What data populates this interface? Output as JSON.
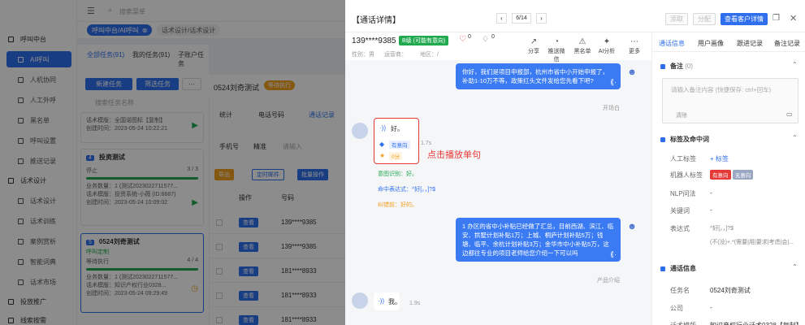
{
  "nav": {
    "items": [
      {
        "label": "呼叫中台",
        "type": "group"
      },
      {
        "label": "AI呼叫",
        "type": "active"
      },
      {
        "label": "人机协同"
      },
      {
        "label": "人工外呼"
      },
      {
        "label": "黑名单"
      },
      {
        "label": "呼叫设置"
      },
      {
        "label": "推送记录"
      },
      {
        "label": "话术设计",
        "type": "group"
      },
      {
        "label": "话术设计"
      },
      {
        "label": "话术训练"
      },
      {
        "label": "案例赏析"
      },
      {
        "label": "智能词典"
      },
      {
        "label": "话术市场"
      },
      {
        "label": "投放推广",
        "type": "group"
      },
      {
        "label": "线索按需",
        "type": "group"
      }
    ]
  },
  "topbar": {
    "search_placeholder": "搜索菜单"
  },
  "tabs": [
    {
      "label": "呼叫中台/AI呼叫"
    },
    {
      "label": "话术设计/话术设计"
    }
  ],
  "task_tabs": [
    "全部任务(91)",
    "我的任务(91)",
    "子账户任务"
  ],
  "list": {
    "new_button": "新建任务",
    "filter_button": "筛选任务",
    "more": "···",
    "search_placeholder": "搜索任务名称",
    "cards": [
      {
        "title": "",
        "lines": [
          "话术模版：全国诺图标【复制】",
          "创建时间：2023-05-24 10:22:21"
        ]
      },
      {
        "badge": "4",
        "title": "投资测试",
        "status": "停止",
        "progress_text": "3 / 3",
        "progress": 1.0,
        "lines": [
          "业务数量：1 (测试2023022711577...",
          "话术模版：投资系统-小薇 (ID:8687)",
          "创建时间：2023-05-24 10:09:02"
        ]
      },
      {
        "badge": "5",
        "title": "0524刘奇测试",
        "tag": "呼叫定制",
        "status": "等待执行",
        "progress_text": "4 / 4",
        "progress": 1.0,
        "lines": [
          "业务数量：1 (测试2023022711577...",
          "话术模版：知识产权行业0328...",
          "创建时间：2023-05-24 09:29:49"
        ]
      }
    ]
  },
  "detail": {
    "title": "0524刘奇测试",
    "status": "等待执行",
    "sub_tabs": [
      "统计",
      "电话号码",
      "通话记录",
      "..."
    ],
    "filters": [
      "手机号",
      "精准",
      "请输入"
    ],
    "actions": [
      "导出",
      "定时邮件",
      "批量操作"
    ],
    "columns": [
      "操作",
      "号码"
    ],
    "rows": [
      {
        "op": "查看",
        "num": "139****9385"
      },
      {
        "op": "查看",
        "num": "139****9385"
      },
      {
        "op": "查看",
        "num": "181****8933"
      },
      {
        "op": "查看",
        "num": "181****8933"
      },
      {
        "op": "查看",
        "num": "181****8933"
      }
    ]
  },
  "drawer": {
    "title": "【通话详情】",
    "pager": "6/14",
    "header_buttons": [
      "添取",
      "分配",
      "查看客户详情"
    ],
    "phone": "139****9385",
    "level_tag": "B级 (可能有意向)",
    "likes": "0",
    "dislikes": "0",
    "sub_info": [
      "性别：男",
      "运营商：",
      "地区：/"
    ],
    "icon_actions": [
      {
        "label": "分享",
        "icon": "share-icon",
        "glyph": "↗"
      },
      {
        "label": "推送微信",
        "icon": "chat-icon",
        "glyph": "◔"
      },
      {
        "label": "黑名单",
        "icon": "warning-icon",
        "glyph": "⚠"
      },
      {
        "label": "AI分析",
        "icon": "ai-icon",
        "glyph": "✦"
      },
      {
        "label": "更多",
        "icon": "more-icon",
        "glyph": "⋯"
      }
    ]
  },
  "chat": {
    "msg1": "你好，我们是项目申报部，杭州市省中小开始申报了，补助1-10万不等，政策红头文件发给您先看下吧?",
    "msg1_tag": "开场白",
    "reply1": "好。",
    "reply1_time": "1.7s",
    "reply1_tags": [
      "有意向",
      "0分"
    ],
    "annotation": "点击播放单句",
    "intent_lines": [
      "意图识别：好。",
      "命中表达式：^好[。，]?$",
      "纠错前：好的。"
    ],
    "msg2": "1 办区的省中小补贴已经做了汇总，目前西湖、滨江、临安、拱墅计划补贴1万；上城、桐庐计划补贴5万；钱塘、临平、余杭计划补贴3万；金华市中小补贴5万，这边都往专业的项目老师给您介绍一下可以吗",
    "msg2_tag": "产品介绍",
    "reply2": "我。",
    "reply2_time": "1.9s"
  },
  "right": {
    "tabs": [
      "通话信息",
      "用户画像",
      "跟进记录",
      "备注记录"
    ],
    "remark_title": "备注",
    "remark_count": "(0)",
    "remark_placeholder": "请输入备注内容 (快捷保存: ctrl+回车)",
    "clear": "清除",
    "tags_title": "标签及命中词",
    "tag_rows": [
      {
        "label": "人工标签",
        "value": "+ 标签"
      },
      {
        "label": "机器人标签",
        "tags": [
          "有意向",
          "无意向"
        ]
      },
      {
        "label": "NLP问法",
        "value": "-"
      },
      {
        "label": "关键词",
        "value": "-"
      },
      {
        "label": "表达式",
        "value": "^好[。，]?$"
      },
      {
        "label": "",
        "value": "(不(没)+.*(需要|用|要求|考虑|会|..."
      }
    ],
    "call_title": "通话信息",
    "call_rows": [
      {
        "label": "任务名",
        "value": "0524刘奇测试"
      },
      {
        "label": "公司",
        "value": "-"
      },
      {
        "label": "话术模版",
        "value": "知识产权行业话术0328【复制】"
      }
    ]
  },
  "colors": {
    "primary": "#2f6fed",
    "annotation": "#e53935",
    "success": "#21a94f"
  }
}
